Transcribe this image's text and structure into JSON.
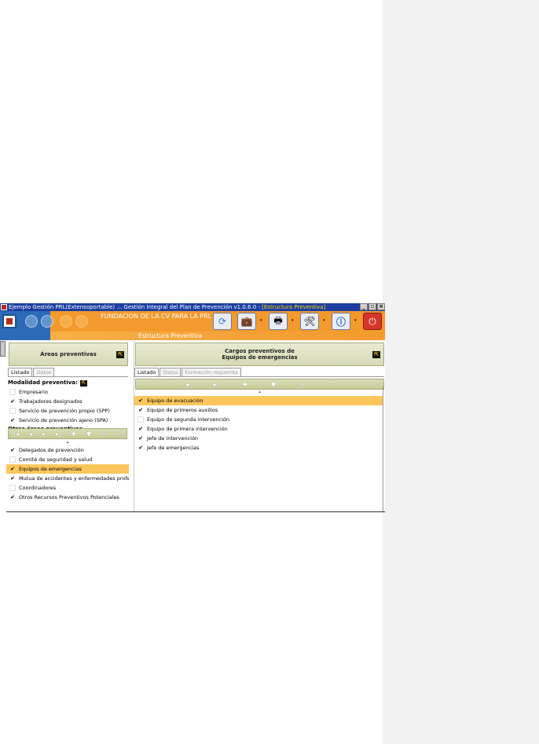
{
  "window": {
    "title_prefix": "Ejemplo Gestión PRL(Extensoportable) .:. Gestión Integral del Plan de Prevención v1.0.6.0 - ",
    "title_module": "[Estructura Preventiva]",
    "min_label": "_",
    "max_label": "▫",
    "close_label": "×"
  },
  "banner": {
    "org_name": "FUNDACION DE LA CV PARA LA PRL",
    "section": "Estructura Preventiva",
    "colors": {
      "orange": "#f39a2c",
      "blue": "#2c6bb6",
      "selection": "#fbc65c"
    },
    "toolbar": [
      {
        "icon": "sync-icon",
        "glyph": "⟳"
      },
      {
        "icon": "briefcase-icon",
        "glyph": "💼"
      },
      {
        "icon": "printer-icon",
        "glyph": "🖶"
      },
      {
        "icon": "tools-icon",
        "glyph": "🛠"
      },
      {
        "icon": "info-icon",
        "glyph": "ⓘ"
      },
      {
        "icon": "power-icon",
        "glyph": "⏻"
      }
    ]
  },
  "left": {
    "header": "Áreas preventivas",
    "tabs": [
      "Listado",
      "Datos"
    ],
    "modalidad_label": "Modalidad preventiva:",
    "modalidad_items": [
      {
        "label": "Empresario",
        "checked": false
      },
      {
        "label": "Trabajadores designados",
        "checked": true
      },
      {
        "label": "Servicio de prevención propio (SPP)",
        "checked": false
      },
      {
        "label": "Servicio de prevención ajeno (SPA)",
        "checked": true
      }
    ],
    "otras_label": "Otras áreas preventivas",
    "otras_items": [
      {
        "label": "Delegados de prevención",
        "checked": true,
        "selected": false
      },
      {
        "label": "Comité de seguridad y salud",
        "checked": false,
        "selected": false
      },
      {
        "label": "Equipos de emergencias",
        "checked": true,
        "selected": true
      },
      {
        "label": "Mutua de accidentes y enfermedades profe",
        "checked": true,
        "selected": false
      },
      {
        "label": "Coordinadores",
        "checked": false,
        "selected": false
      },
      {
        "label": "Otros Recursos Preventivos Potenciales",
        "checked": true,
        "selected": false
      }
    ]
  },
  "right": {
    "header_line1": "Cargos preventivos de",
    "header_line2": "Equipos de emergencias",
    "tabs": [
      "Listado",
      "Datos",
      "Formación requerida"
    ],
    "items": [
      {
        "label": "Equipo de evacuación",
        "checked": true,
        "selected": true
      },
      {
        "label": "Equipo de primeros auxilios",
        "checked": true,
        "selected": false
      },
      {
        "label": "Equipo de segunda intervención",
        "checked": false,
        "selected": false
      },
      {
        "label": "Equipo de primera intervención",
        "checked": true,
        "selected": false
      },
      {
        "label": "Jefe de intervención",
        "checked": true,
        "selected": false
      },
      {
        "label": "Jefe de emergencias",
        "checked": true,
        "selected": false
      }
    ]
  },
  "nav": {
    "first": "|◂",
    "prev": "◂",
    "next": "▸",
    "last": "▸|",
    "add": "✚",
    "filter": "▼",
    "edit": "✎",
    "fullscreen": "⛶",
    "caret": "▴",
    "check": "✔"
  }
}
